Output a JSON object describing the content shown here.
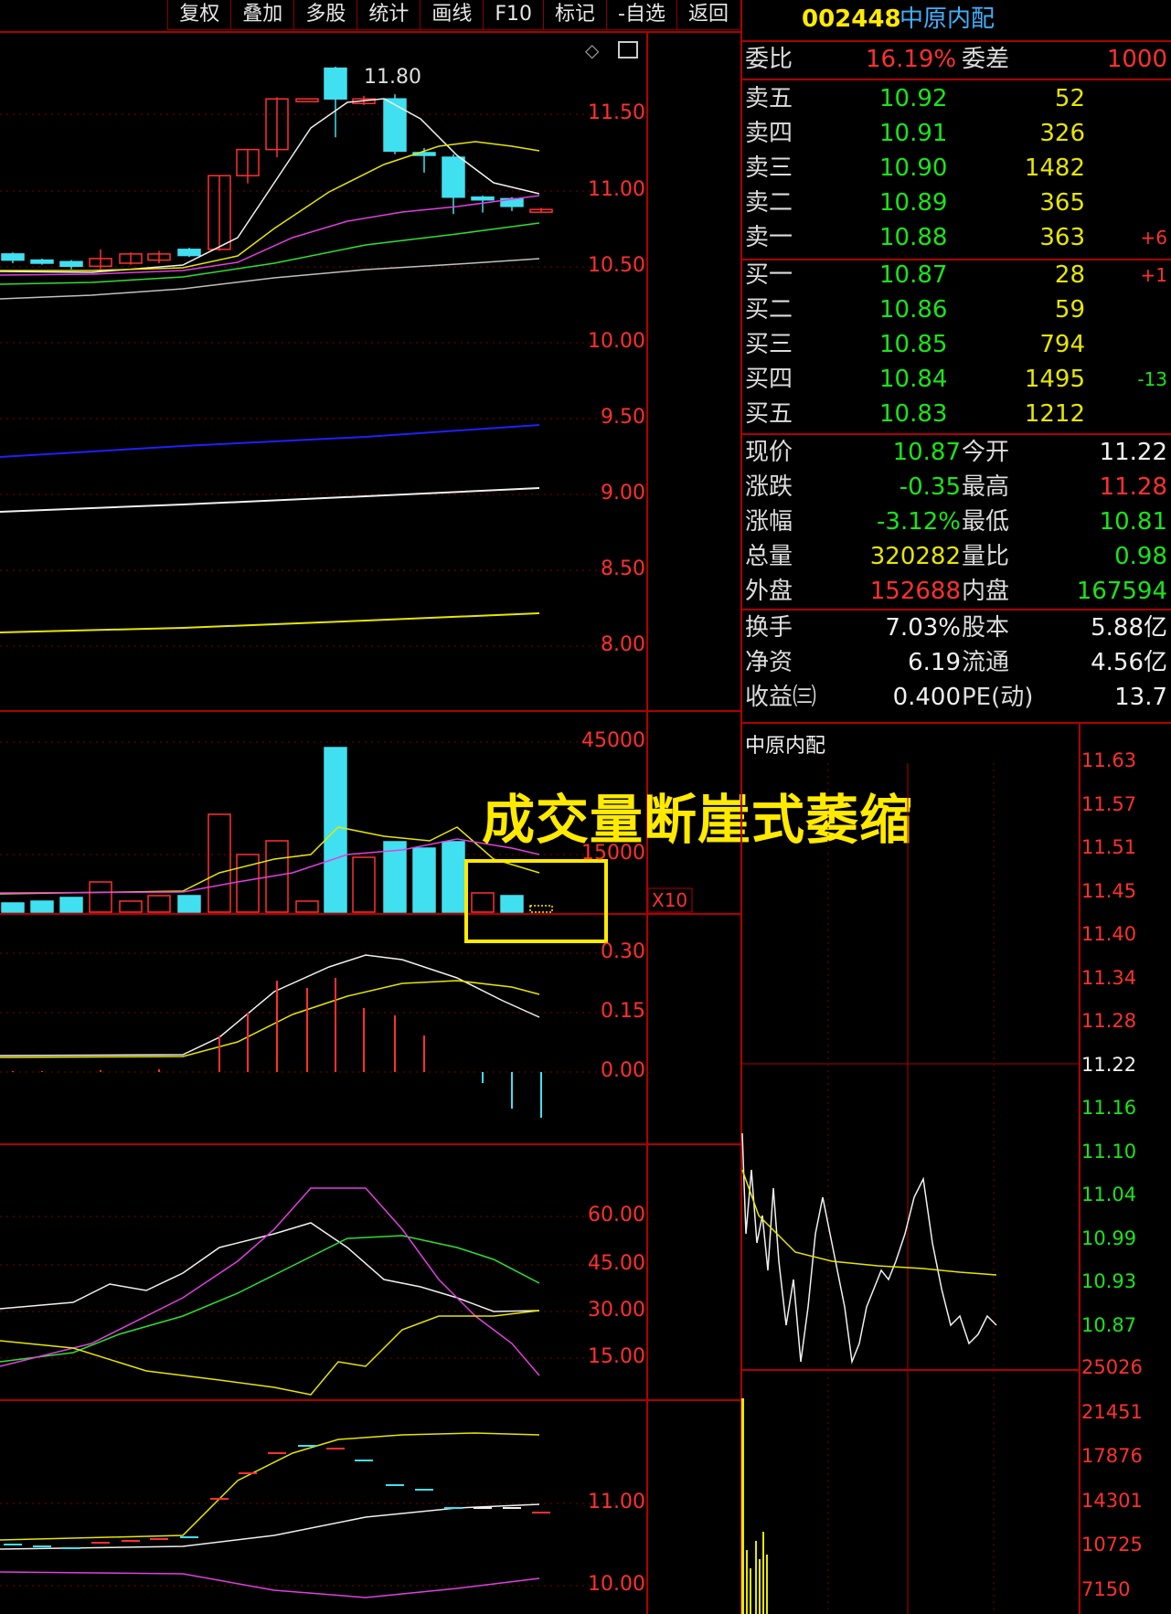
{
  "toolbar": {
    "items": [
      "复权",
      "叠加",
      "多股",
      "统计",
      "画线",
      "F10",
      "标记",
      "-自选",
      "返回"
    ]
  },
  "header": {
    "code": "002448",
    "name": "中原内配"
  },
  "quote": {
    "weibi_label": "委比",
    "weibi_value": "16.19%",
    "weicha_label": "委差",
    "weicha_value": "1000",
    "asks": [
      {
        "label": "卖五",
        "price": "10.92",
        "vol": "52",
        "chg": ""
      },
      {
        "label": "卖四",
        "price": "10.91",
        "vol": "326",
        "chg": ""
      },
      {
        "label": "卖三",
        "price": "10.90",
        "vol": "1482",
        "chg": ""
      },
      {
        "label": "卖二",
        "price": "10.89",
        "vol": "365",
        "chg": ""
      },
      {
        "label": "卖一",
        "price": "10.88",
        "vol": "363",
        "chg": "+6"
      }
    ],
    "bids": [
      {
        "label": "买一",
        "price": "10.87",
        "vol": "28",
        "chg": "+1"
      },
      {
        "label": "买二",
        "price": "10.86",
        "vol": "59",
        "chg": ""
      },
      {
        "label": "买三",
        "price": "10.85",
        "vol": "794",
        "chg": ""
      },
      {
        "label": "买四",
        "price": "10.84",
        "vol": "1495",
        "chg": "-13"
      },
      {
        "label": "买五",
        "price": "10.83",
        "vol": "1212",
        "chg": ""
      }
    ],
    "stats": [
      {
        "l1": "现价",
        "v1": "10.87",
        "l2": "今开",
        "v2": "11.22",
        "c1": "green",
        "c2": "white"
      },
      {
        "l1": "涨跌",
        "v1": "-0.35",
        "l2": "最高",
        "v2": "11.28",
        "c1": "green",
        "c2": "red"
      },
      {
        "l1": "涨幅",
        "v1": "-3.12%",
        "l2": "最低",
        "v2": "10.81",
        "c1": "green",
        "c2": "green"
      },
      {
        "l1": "总量",
        "v1": "320282",
        "l2": "量比",
        "v2": "0.98",
        "c1": "yellow",
        "c2": "green"
      },
      {
        "l1": "外盘",
        "v1": "152688",
        "l2": "内盘",
        "v2": "167594",
        "c1": "red",
        "c2": "green"
      }
    ],
    "fund": [
      {
        "l1": "换手",
        "v1": "7.03%",
        "l2": "股本",
        "v2": "5.88亿"
      },
      {
        "l1": "净资",
        "v1": "6.19",
        "l2": "流通",
        "v2": "4.56亿"
      },
      {
        "l1": "收益㈢",
        "v1": "0.400",
        "l2": "PE(动)",
        "v2": "13.7"
      }
    ]
  },
  "intraday": {
    "title": "中原内配",
    "price_ticks": [
      "11.63",
      "11.57",
      "11.51",
      "11.45",
      "11.40",
      "11.34",
      "11.28",
      "11.22",
      "11.16",
      "11.10",
      "11.04",
      "10.99",
      "10.93",
      "10.87"
    ],
    "volume_ticks": [
      "25026",
      "21451",
      "17876",
      "14301",
      "10725",
      "7150"
    ]
  },
  "kline": {
    "price_ticks": [
      "11.50",
      "11.00",
      "10.50",
      "10.00",
      "9.50",
      "9.00",
      "8.50",
      "8.00"
    ],
    "high_label": "11.80",
    "volume_ticks": [
      "45000",
      "15000"
    ],
    "volume_unit": "X10",
    "macd_ticks": [
      "0.30",
      "0.15",
      "0.00"
    ],
    "kdj_ticks": [
      "60.00",
      "45.00",
      "30.00",
      "15.00"
    ],
    "bottom_ticks": [
      "11.00",
      "10.00"
    ],
    "annotation": "成交量断崖式萎缩"
  },
  "colors": {
    "grid": "#b00000",
    "up": "#ff3030",
    "down": "#40e0f0",
    "accent": "#ffea00"
  }
}
